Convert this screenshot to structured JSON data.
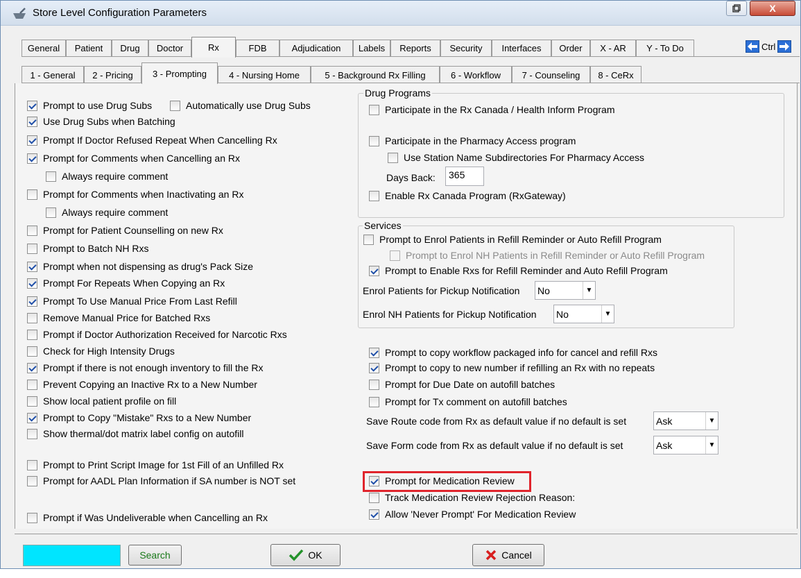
{
  "window": {
    "title": "Store Level Configuration Parameters",
    "close_label": "X"
  },
  "tabs_top": [
    {
      "label": "General",
      "active": false
    },
    {
      "label": "Patient",
      "active": false
    },
    {
      "label": "Drug",
      "active": false
    },
    {
      "label": "Doctor",
      "active": false
    },
    {
      "label": "Rx",
      "active": true
    },
    {
      "label": "FDB",
      "active": false
    },
    {
      "label": "Adjudication",
      "active": false
    },
    {
      "label": "Labels",
      "active": false
    },
    {
      "label": "Reports",
      "active": false
    },
    {
      "label": "Security",
      "active": false
    },
    {
      "label": "Interfaces",
      "active": false
    },
    {
      "label": "Order",
      "active": false
    },
    {
      "label": "X - AR",
      "active": false
    },
    {
      "label": "Y - To Do",
      "active": false
    }
  ],
  "ctrl_nav": {
    "label": "Ctrl"
  },
  "tabs_sub": [
    {
      "label": "1 - General",
      "active": false
    },
    {
      "label": "2 - Pricing",
      "active": false
    },
    {
      "label": "3 - Prompting",
      "active": true
    },
    {
      "label": "4 - Nursing Home",
      "active": false
    },
    {
      "label": "5 - Background Rx Filling",
      "active": false
    },
    {
      "label": "6 - Workflow",
      "active": false
    },
    {
      "label": "7 - Counseling",
      "active": false
    },
    {
      "label": "8 - CeRx",
      "active": false
    }
  ],
  "left": {
    "drug_subs": {
      "label": "Prompt to use Drug Subs",
      "checked": true
    },
    "auto_drug_subs": {
      "label": "Automatically use Drug Subs",
      "checked": false
    },
    "items": [
      {
        "label": "Use Drug Subs when Batching",
        "checked": true
      },
      {
        "label": "Prompt If Doctor Refused Repeat When Cancelling Rx",
        "checked": true
      },
      {
        "label": "Prompt for Comments when Cancelling an Rx",
        "checked": true
      },
      {
        "label": "Always require comment",
        "checked": false
      },
      {
        "label": "Prompt for Comments when Inactivating an Rx",
        "checked": false
      },
      {
        "label": "Always require comment",
        "checked": false
      },
      {
        "label": "Prompt for Patient Counselling on new Rx",
        "checked": false
      },
      {
        "label": "Prompt to Batch NH Rxs",
        "checked": false
      },
      {
        "label": "Prompt when not dispensing as drug's Pack Size",
        "checked": true
      },
      {
        "label": "Prompt For Repeats When Copying an Rx",
        "checked": true
      },
      {
        "label": "Prompt To Use Manual Price From Last Refill",
        "checked": true
      },
      {
        "label": "Remove Manual Price for Batched Rxs",
        "checked": false
      },
      {
        "label": "Prompt if Doctor Authorization Received for Narcotic Rxs",
        "checked": false
      },
      {
        "label": "Check for High Intensity Drugs",
        "checked": false
      },
      {
        "label": "Prompt if there is not enough inventory to fill the Rx",
        "checked": true
      },
      {
        "label": "Prevent Copying  an Inactive Rx to a New Number",
        "checked": false
      },
      {
        "label": "Show local patient profile on fill",
        "checked": false
      },
      {
        "label": "Prompt to Copy \"Mistake\" Rxs to a New Number",
        "checked": true
      },
      {
        "label": "Show thermal/dot matrix label config on autofill",
        "checked": false
      },
      {
        "label": "Prompt to Print Script Image for 1st Fill of an Unfilled Rx",
        "checked": false
      },
      {
        "label": "Prompt for AADL Plan Information if SA number is NOT set",
        "checked": false
      },
      {
        "label": "Prompt if Was Undeliverable when Cancelling an Rx",
        "checked": false
      }
    ]
  },
  "drug_programs": {
    "title": "Drug Programs",
    "rx_canada_health_inform": {
      "label": "Participate in the Rx Canada / Health Inform Program",
      "checked": false
    },
    "pharmacy_access": {
      "label": "Participate in the Pharmacy Access program",
      "checked": false
    },
    "station_subdirs": {
      "label": "Use Station Name Subdirectories For Pharmacy Access",
      "checked": false
    },
    "days_back_label": "Days Back:",
    "days_back_value": "365",
    "rx_gateway": {
      "label": "Enable Rx Canada Program (RxGateway)",
      "checked": false
    }
  },
  "services": {
    "title": "Services",
    "enrol_refill": {
      "label": "Prompt to Enrol Patients in Refill Reminder or Auto Refill Program",
      "checked": false
    },
    "enrol_nh_refill": {
      "label": "Prompt to Enrol NH Patients in Refill Reminder or Auto Refill Program",
      "checked": false
    },
    "enable_rxs_refill": {
      "label": "Prompt to Enable Rxs for Refill Reminder and Auto Refill Program",
      "checked": true
    },
    "pickup_label": "Enrol Patients for Pickup Notification",
    "pickup_value": "No",
    "nh_pickup_label": "Enrol NH Patients for Pickup Notification",
    "nh_pickup_value": "No"
  },
  "right_lower": {
    "items": [
      {
        "label": "Prompt to copy workflow packaged info for cancel and refill Rxs",
        "checked": true
      },
      {
        "label": "Prompt to copy to new number if refilling an Rx with no repeats",
        "checked": true
      },
      {
        "label": "Prompt for Due Date on autofill batches",
        "checked": false
      },
      {
        "label": "Prompt for Tx comment on autofill batches",
        "checked": false
      }
    ],
    "route_label": "Save Route code from Rx as default value if no default is set",
    "route_value": "Ask",
    "form_label": "Save Form code from Rx as default value if no default is set",
    "form_value": "Ask",
    "med_review": {
      "label": "Prompt for Medication Review",
      "checked": true
    },
    "track_rejection": {
      "label": "Track Medication Review Rejection Reason:",
      "checked": false
    },
    "never_prompt": {
      "label": "Allow 'Never Prompt' For Medication Review",
      "checked": true
    }
  },
  "bottom": {
    "search_value": "",
    "search_label": "Search",
    "ok_label": "OK",
    "cancel_label": "Cancel"
  },
  "colors": {
    "search_field": "#00e5ff",
    "highlight": "#e0242c",
    "check": "#1f4fa8"
  }
}
